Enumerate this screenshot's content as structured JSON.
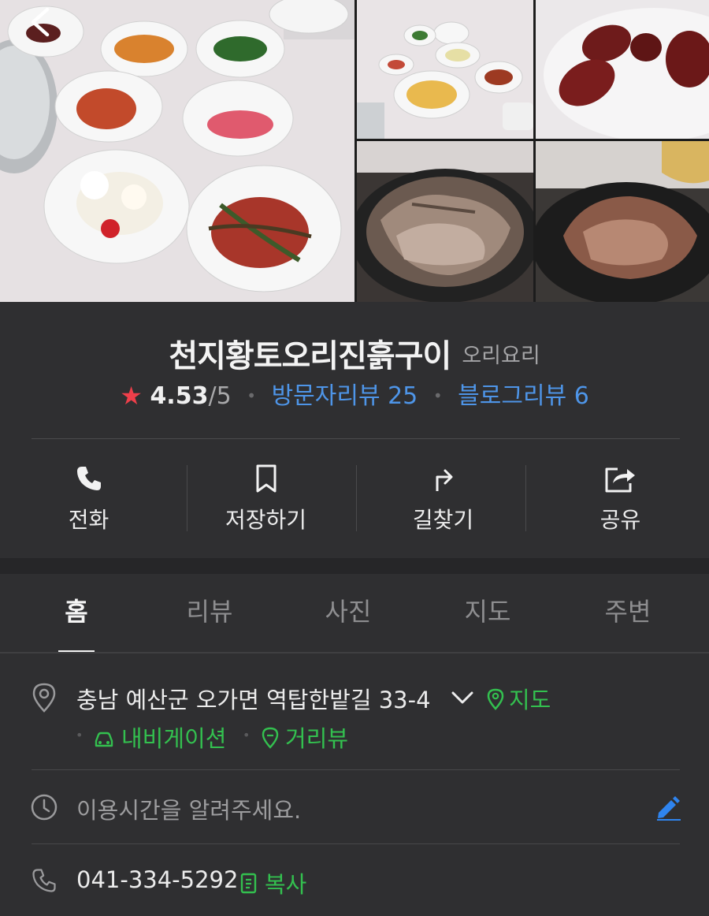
{
  "place": {
    "name": "천지황토오리진흙구이",
    "category": "오리요리",
    "rating": "4.53",
    "rating_max": "/5",
    "visitor_reviews": "방문자리뷰 25",
    "blog_reviews": "블로그리뷰 6"
  },
  "actions": [
    {
      "label": "전화",
      "icon": "phone-icon"
    },
    {
      "label": "저장하기",
      "icon": "bookmark-icon"
    },
    {
      "label": "길찾기",
      "icon": "directions-icon"
    },
    {
      "label": "공유",
      "icon": "share-icon"
    }
  ],
  "tabs": [
    {
      "label": "홈",
      "active": true
    },
    {
      "label": "리뷰",
      "active": false
    },
    {
      "label": "사진",
      "active": false
    },
    {
      "label": "지도",
      "active": false
    },
    {
      "label": "주변",
      "active": false
    }
  ],
  "info": {
    "address": "충남 예산군 오가면 역탑한밭길 33-4",
    "map_link": "지도",
    "navigation_link": "내비게이션",
    "roadview_link": "거리뷰",
    "hours_placeholder": "이용시간을 알려주세요.",
    "phone": "041-334-5292",
    "copy_label": "복사"
  },
  "colors": {
    "background": "#2f2f31",
    "link_blue": "#4e95e8",
    "link_green": "#33c04f",
    "star_red": "#ef3f4a",
    "edit_blue": "#2f84ee"
  }
}
